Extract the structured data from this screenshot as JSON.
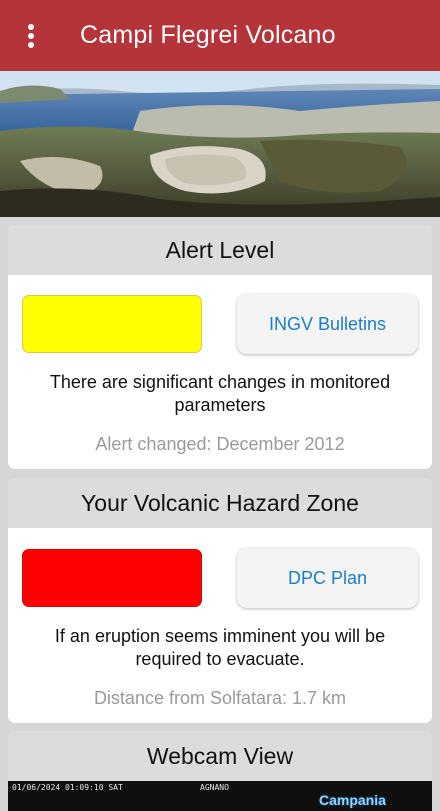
{
  "appbar": {
    "title": "Campi Flegrei Volcano",
    "menu_icon": "more-vert-icon"
  },
  "hero": {
    "image": "aerial-photo-solfatara-crater-and-bay"
  },
  "alert": {
    "header": "Alert Level",
    "level_color": "#ffff00",
    "button_label": "INGV Bulletins",
    "message": "There are significant changes in monitored parameters",
    "changed": "Alert changed: December 2012"
  },
  "zone": {
    "header": "Your Volcanic Hazard Zone",
    "zone_color": "#ff0000",
    "button_label": "DPC Plan",
    "message": "If an eruption seems imminent you will be required to evacuate.",
    "distance": "Distance from Solfatara: 1.7 km"
  },
  "webcam": {
    "header": "Webcam View",
    "timestamp": "01/06/2024 01:09:10 SAT",
    "location": "AGNANO",
    "logo": "Campania"
  },
  "colors": {
    "appbar": "#b5343a",
    "accent_link": "#1a7fc7",
    "card_header_bg": "#dcdcdc",
    "muted_text": "#9a9a9a"
  }
}
